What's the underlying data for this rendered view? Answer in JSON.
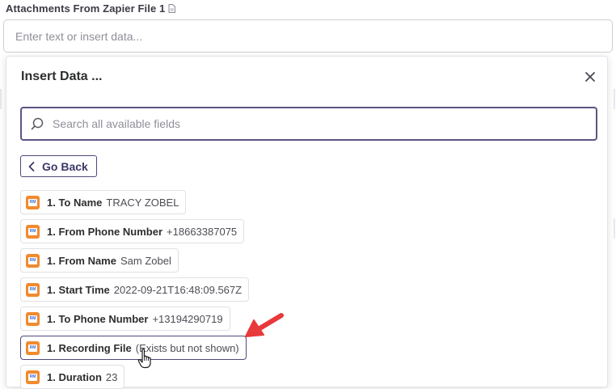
{
  "field": {
    "label": "Attachments From Zapier File 1",
    "placeholder": "Enter text or insert data..."
  },
  "popover": {
    "title": "Insert Data ...",
    "search_placeholder": "Search all available fields",
    "go_back_label": "Go Back"
  },
  "items": [
    {
      "key": "1. To Name",
      "value": "TRACY ZOBEL"
    },
    {
      "key": "1. From Phone Number",
      "value": "+18663387075"
    },
    {
      "key": "1. From Name",
      "value": "Sam Zobel"
    },
    {
      "key": "1. Start Time",
      "value": "2022-09-21T16:48:09.567Z"
    },
    {
      "key": "1. To Phone Number",
      "value": "+13194290719"
    },
    {
      "key": "1. Recording File",
      "value": "(Exists but not shown)"
    },
    {
      "key": "1. Duration",
      "value": "23"
    }
  ],
  "icons": {
    "field_label_icon": "document-icon",
    "close": "close-icon",
    "search": "search-icon",
    "back": "chevron-left-icon",
    "app": "app-icon",
    "annotation": "red-arrow-icon",
    "cursor": "hand-cursor-icon"
  },
  "colors": {
    "accent": "#4d4a7a",
    "app_icon": "#f28a2e",
    "annotation_arrow": "#e8393b"
  }
}
